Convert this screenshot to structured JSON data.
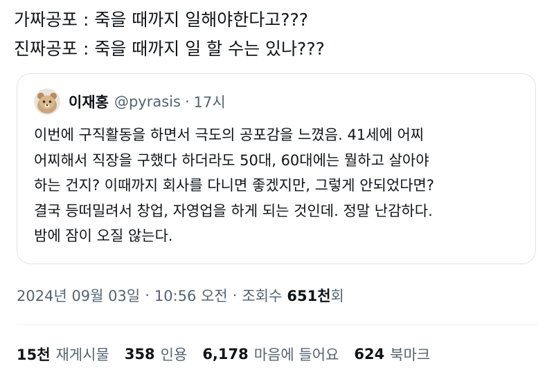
{
  "tweet": {
    "lines": [
      "가짜공포 : 죽을 때까지 일해야한다고???",
      "진짜공포 : 죽을 때까지 일 할 수는 있나???"
    ]
  },
  "quote": {
    "author_name": "이재홍",
    "author_handle": "@pyrasis",
    "separator": "·",
    "age": "17시",
    "avatar_icon": "profile-photo",
    "lines": [
      "이번에 구직활동을 하면서 극도의 공포감을 느꼈음. 41세에 어찌",
      "어찌해서 직장을 구했다 하더라도 50대, 60대에는 뭘하고 살아야",
      "하는 건지? 이때까지 회사를 다니면 좋겠지만, 그렇게 안되었다면?",
      "결국 등떠밀려서 창업, 자영업을 하게 되는 것인데. 정말 난감하다.",
      "밤에 잠이 오질 않는다."
    ]
  },
  "meta": {
    "date": "2024년 09월 03일",
    "separator": "·",
    "time": "10:56 오전",
    "views_label": "조회수",
    "views_count": "651천",
    "views_suffix": "회"
  },
  "stats": [
    {
      "count": "15천",
      "label": "재게시물"
    },
    {
      "count": "358",
      "label": "인용"
    },
    {
      "count": "6,178",
      "label": "마음에 들어요"
    },
    {
      "count": "624",
      "label": "북마크"
    }
  ],
  "colors": {
    "text_primary": "#0f1419",
    "text_secondary": "#536471",
    "border": "#dfe3e7"
  }
}
